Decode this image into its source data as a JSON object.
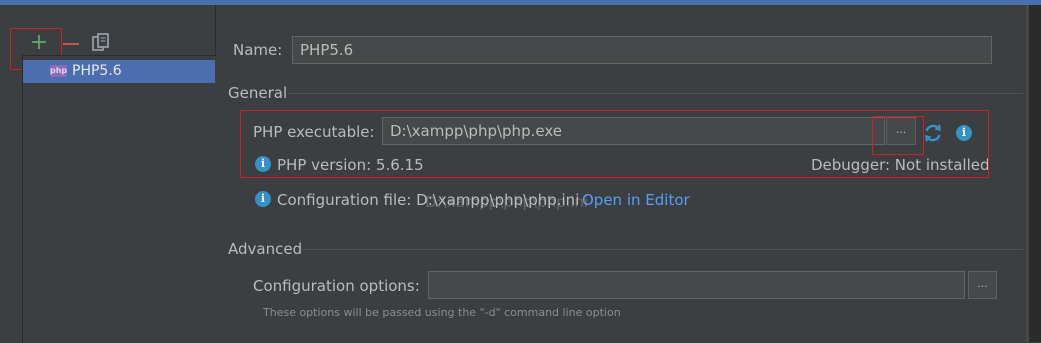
{
  "toolbar": {
    "add_label": "+",
    "add_icon": "plus-icon",
    "remove_icon": "minus-icon",
    "copy_icon": "copy-icon"
  },
  "tree": {
    "items": [
      {
        "label": "PHP5.6",
        "icon": "php-icon",
        "icon_text": "php"
      }
    ]
  },
  "form": {
    "name_label": "Name:",
    "name_value": "PHP5.6",
    "general_label": "General",
    "exe_label": "PHP executable:",
    "exe_value": "D:\\xampp\\php\\php.exe",
    "browse_label": "...",
    "version_text": "PHP version: 5.6.15",
    "debugger_text": "Debugger: Not installed",
    "config_label": "Configuration file: D:\\xampp\\php\\php.ini",
    "open_editor": "Open in Editor",
    "ghost_overlay": "D:\\xampp\\php\\php.ini",
    "advanced_label": "Advanced",
    "options_label": "Configuration options:",
    "options_value": "",
    "options_browse": "...",
    "hint": "These options will be passed using the \"-d\" command line option"
  },
  "colors": {
    "background": "#3c3f41",
    "selection": "#4b6eaf",
    "link": "#589df6",
    "add_green": "#59a869",
    "remove_red": "#c75450",
    "info_blue": "#3592c4",
    "annotation_red": "#cc2222"
  }
}
